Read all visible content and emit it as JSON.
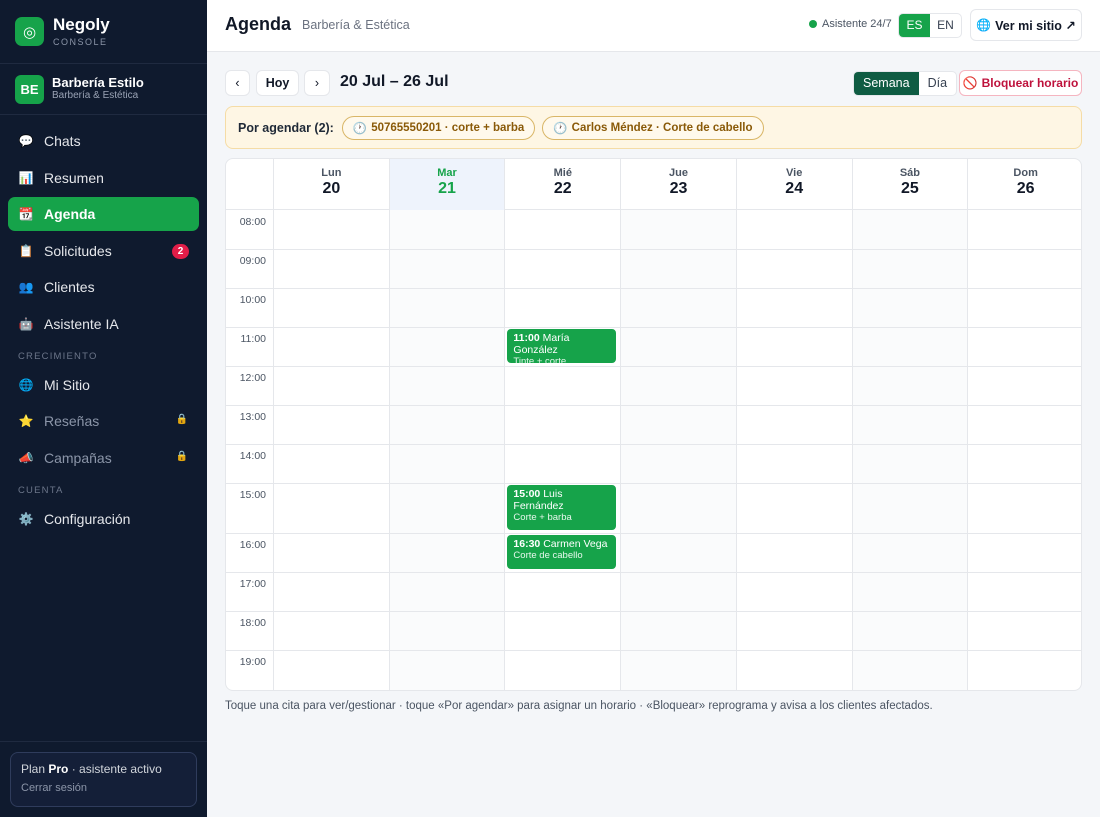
{
  "brand": {
    "name": "Negoly",
    "sub": "CONSOLE",
    "logo_icon": "target-icon"
  },
  "business": {
    "initials": "BE",
    "name": "Barbería Estilo",
    "sub": "Barbería & Estética"
  },
  "nav": {
    "items": [
      {
        "label": "Chats",
        "icon": "chat-icon",
        "glyph": "💬"
      },
      {
        "label": "Resumen",
        "icon": "chart-icon",
        "glyph": "📊"
      },
      {
        "label": "Agenda",
        "icon": "calendar-icon",
        "glyph": "📆",
        "active": true
      },
      {
        "label": "Solicitudes",
        "icon": "clipboard-icon",
        "glyph": "📋",
        "badge": "2"
      },
      {
        "label": "Clientes",
        "icon": "users-icon",
        "glyph": "👥"
      },
      {
        "label": "Asistente IA",
        "icon": "robot-icon",
        "glyph": "🤖"
      }
    ],
    "section_growth": "CRECIMIENTO",
    "growth_items": [
      {
        "label": "Mi Sitio",
        "icon": "globe-icon",
        "glyph": "🌐"
      },
      {
        "label": "Reseñas",
        "icon": "star-icon",
        "glyph": "⭐",
        "locked": true
      },
      {
        "label": "Campañas",
        "icon": "megaphone-icon",
        "glyph": "📣",
        "locked": true
      }
    ],
    "section_account": "CUENTA",
    "account_items": [
      {
        "label": "Configuración",
        "icon": "gear-icon",
        "glyph": "⚙️"
      }
    ]
  },
  "plan": {
    "prefix": "Plan ",
    "name": "Pro",
    "suffix": " · asistente activo",
    "logout": "Cerrar sesión"
  },
  "header": {
    "title": "Agenda",
    "subtitle": "Barbería & Estética",
    "assistant": "Asistente 24/7",
    "lang": [
      "ES",
      "EN"
    ],
    "lang_selected": "ES",
    "site_button": "Ver mi sitio ↗"
  },
  "toolbar": {
    "prev": "‹",
    "today": "Hoy",
    "next": "›",
    "range": "20 Jul – 26 Jul",
    "views": [
      "Semana",
      "Día"
    ],
    "view_selected": "Semana",
    "block": "Bloquear horario"
  },
  "pending": {
    "label": "Por agendar (2):",
    "items": [
      "50765550201 · corte + barba",
      "Carlos Méndez · Corte de cabello"
    ]
  },
  "calendar": {
    "days": [
      {
        "name": "Lun",
        "num": "20"
      },
      {
        "name": "Mar",
        "num": "21",
        "today": true
      },
      {
        "name": "Mié",
        "num": "22"
      },
      {
        "name": "Jue",
        "num": "23"
      },
      {
        "name": "Vie",
        "num": "24"
      },
      {
        "name": "Sáb",
        "num": "25"
      },
      {
        "name": "Dom",
        "num": "26"
      }
    ],
    "hours": [
      "08:00",
      "09:00",
      "10:00",
      "11:00",
      "12:00",
      "13:00",
      "14:00",
      "15:00",
      "16:00",
      "17:00",
      "18:00",
      "19:00"
    ],
    "events": [
      {
        "day": 2,
        "hour": "11:00",
        "time": "11:00",
        "name": "María González",
        "service": "Tinte + corte"
      },
      {
        "day": 2,
        "hour": "15:00",
        "time": "15:00",
        "name": "Luis Fernández",
        "service": "Corte + barba"
      },
      {
        "day": 2,
        "hour": "16:00",
        "time": "16:30",
        "name": "Carmen Vega",
        "service": "Corte de cabello"
      }
    ]
  },
  "hint": "Toque una cita para ver/gestionar · toque «Por agendar» para asignar un horario · «Bloquear» reprograma y avisa a los clientes afectados.",
  "colors": {
    "accent": "#16a34a",
    "sidebar": "#0f1a2e",
    "danger": "#be123c",
    "pending_bg": "#fef6e4"
  }
}
